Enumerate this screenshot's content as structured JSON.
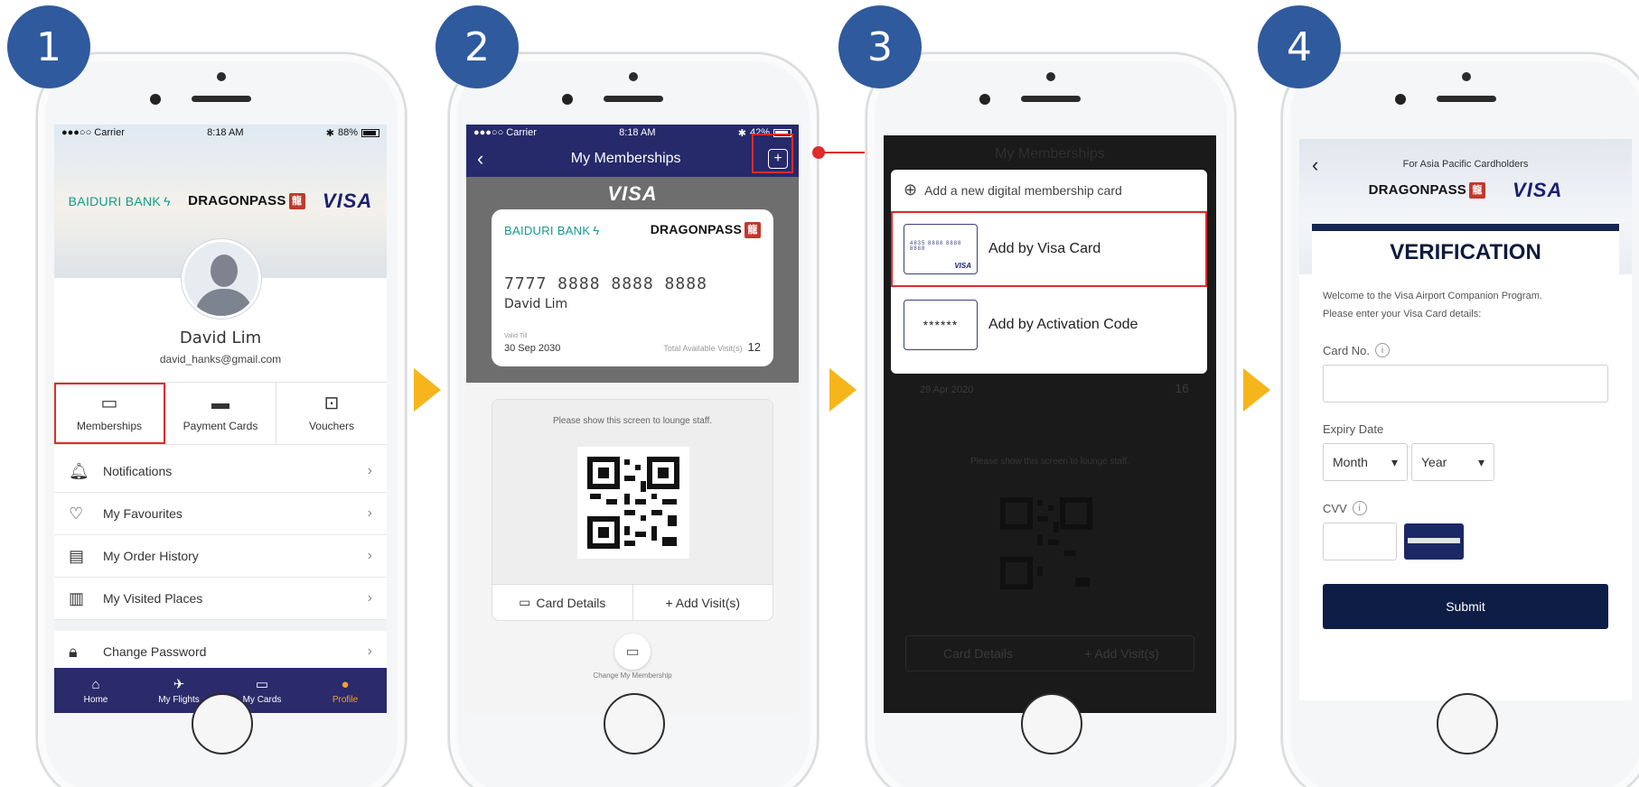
{
  "steps": [
    "1",
    "2",
    "3",
    "4"
  ],
  "status_bar": {
    "carrier": "●●●○○ Carrier",
    "time": "8:18 AM",
    "battery_1": "88%",
    "battery_2": "42%"
  },
  "brands": {
    "bank": "BAIDURI BANK",
    "dragonpass": "DRAGONPASS",
    "dragon_seal": "龍",
    "visa": "VISA"
  },
  "screen1": {
    "name": "David Lim",
    "email": "david_hanks@gmail.com",
    "tiles": [
      {
        "label": "Memberships",
        "icon": "membership-card-icon"
      },
      {
        "label": "Payment Cards",
        "icon": "credit-card-icon"
      },
      {
        "label": "Vouchers",
        "icon": "ticket-icon"
      }
    ],
    "menu": [
      {
        "label": "Notifications",
        "icon": "bell-icon"
      },
      {
        "label": "My Favourites",
        "icon": "heart-icon"
      },
      {
        "label": "My Order History",
        "icon": "clipboard-icon"
      },
      {
        "label": "My Visited Places",
        "icon": "visited-list-icon"
      },
      {
        "label": "Change Password",
        "icon": "lock-icon"
      }
    ],
    "tabs": [
      {
        "label": "Home",
        "icon": "home-icon"
      },
      {
        "label": "My Flights",
        "icon": "plane-icon"
      },
      {
        "label": "My Cards",
        "icon": "card-icon"
      },
      {
        "label": "Profile",
        "icon": "person-icon"
      }
    ],
    "accent": "#2b2a6b",
    "active_tab_color": "#f2a22e"
  },
  "screen2": {
    "title": "My Memberships",
    "card": {
      "number": "7777 8888 8888 8888",
      "holder": "David Lim",
      "valid_label": "Valid Till",
      "valid": "30 Sep 2030",
      "visits_label": "Total Available Visit(s)",
      "visits": "12"
    },
    "qr_hint": "Please show this screen to lounge staff.",
    "btn_details": "Card Details",
    "btn_add": "+ Add Visit(s)",
    "change_label": "Change My Membership"
  },
  "screen3": {
    "ghost_title": "My Memberships",
    "ghost_date": "29 Apr 2020",
    "ghost_visits": "16",
    "ghost_hint": "Please show this screen to lounge staff.",
    "ghost_details": "Card Details",
    "ghost_add": "+ Add Visit(s)",
    "popover_title": "Add a new digital membership card",
    "option_visa": "Add by Visa Card",
    "option_code": "Add by Activation Code",
    "thumb_number": "4835 8888 8888 8888",
    "thumb_visa": "VISA",
    "stars": "******"
  },
  "screen4": {
    "tagline": "For Asia Pacific Cardholders",
    "heading": "VERIFICATION",
    "intro_1": "Welcome to the Visa Airport Companion Program.",
    "intro_2": "Please enter your Visa Card details:",
    "card_no_label": "Card No.",
    "expiry_label": "Expiry Date",
    "month": "Month",
    "year": "Year",
    "cvv_label": "CVV",
    "info": "i",
    "submit": "Submit"
  }
}
